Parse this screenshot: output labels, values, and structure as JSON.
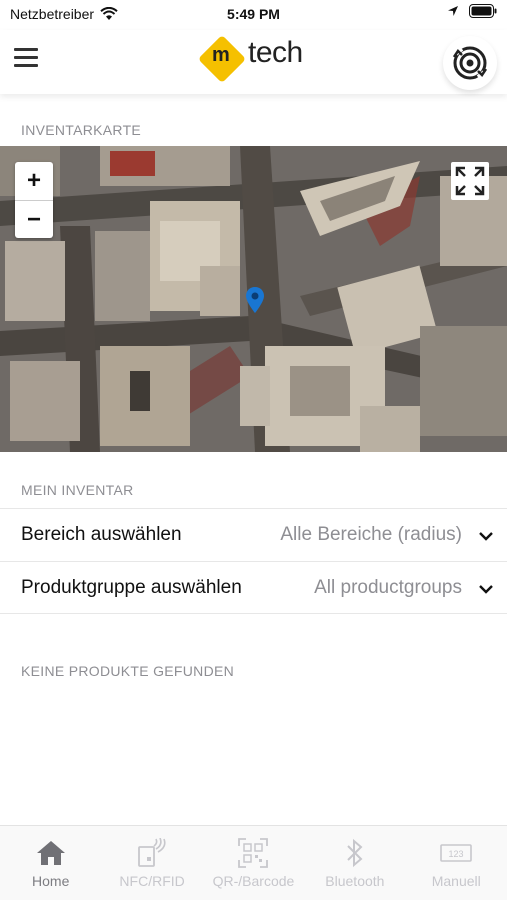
{
  "status_bar": {
    "carrier": "Netzbetreiber",
    "time": "5:49 PM"
  },
  "header": {
    "logo_m": "m",
    "logo_text": "tech",
    "icons": {
      "menu": "hamburger-icon",
      "sync": "sync-target-icon"
    },
    "brand_color": "#f5c000"
  },
  "map_section": {
    "label": "INVENTARKARTE",
    "zoom_in": "+",
    "zoom_out": "−",
    "marker_color": "#1976d2"
  },
  "inventory_section": {
    "label": "MEIN INVENTAR",
    "area_label": "Bereich auswählen",
    "area_value": "Alle Bereiche (radius)",
    "group_label": "Produktgruppe auswählen",
    "group_value": "All productgroups"
  },
  "results": {
    "empty_label": "KEINE PRODUKTE GEFUNDEN"
  },
  "tabs": [
    {
      "label": "Home",
      "icon": "home-icon",
      "active": true
    },
    {
      "label": "NFC/RFID",
      "icon": "nfc-icon",
      "active": false
    },
    {
      "label": "QR-/Barcode",
      "icon": "qr-code-icon",
      "active": false
    },
    {
      "label": "Bluetooth",
      "icon": "bluetooth-icon",
      "active": false
    },
    {
      "label": "Manuell",
      "icon": "keypad-icon",
      "active": false
    }
  ]
}
